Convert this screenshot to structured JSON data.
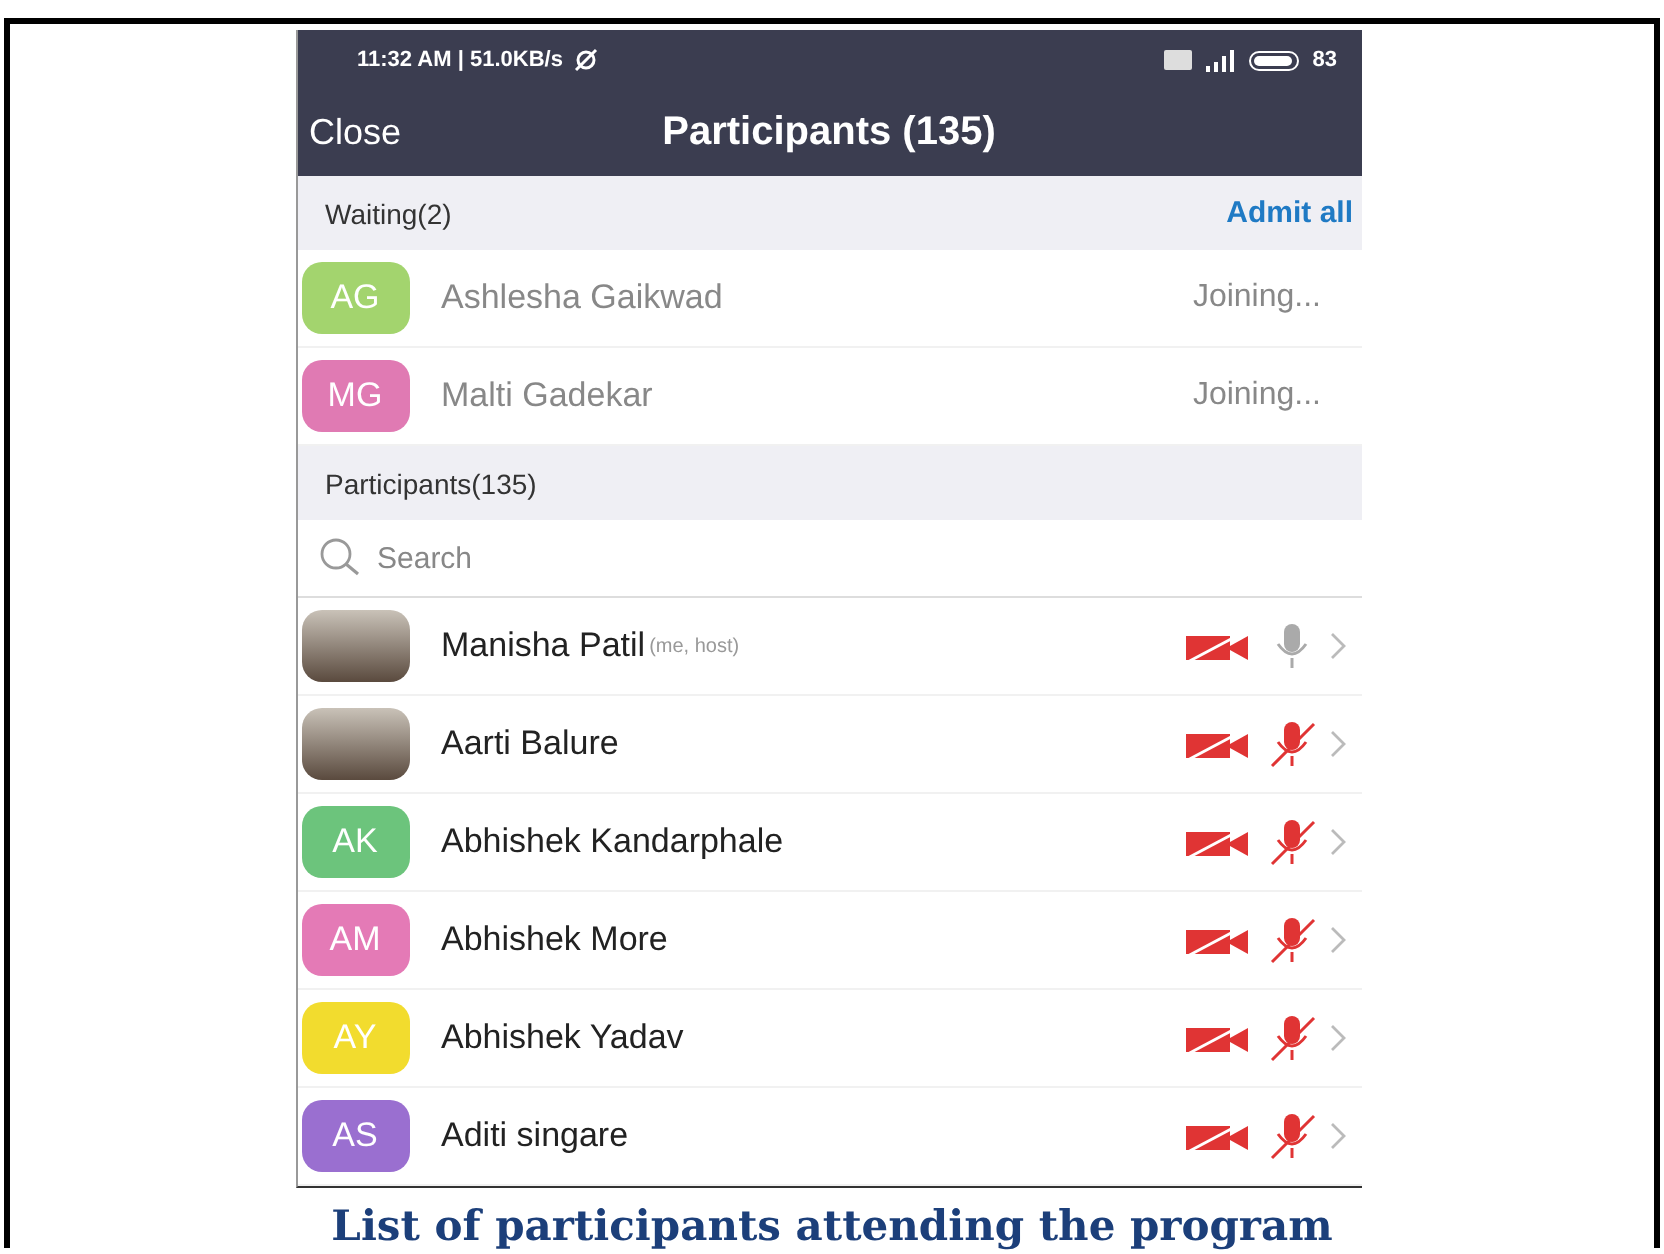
{
  "status_bar": {
    "time": "11:32 AM | 51.0KB/s",
    "battery": "83"
  },
  "nav": {
    "close": "Close",
    "title": "Participants (135)"
  },
  "waiting": {
    "header": "Waiting(2)",
    "admit_all": "Admit all",
    "people": [
      {
        "initials": "AG",
        "color": "#a3d46e",
        "name": "Ashlesha Gaikwad",
        "status": "Joining..."
      },
      {
        "initials": "MG",
        "color": "#e07ab3",
        "name": "Malti Gadekar",
        "status": "Joining..."
      }
    ]
  },
  "participants": {
    "header": "Participants(135)",
    "search": {
      "placeholder": "Search"
    },
    "people": [
      {
        "avatar": {
          "kind": "photo"
        },
        "name": "Manisha Patil",
        "note": "(me, host)",
        "video_muted": true,
        "mic_muted": false
      },
      {
        "avatar": {
          "kind": "photo"
        },
        "name": "Aarti Balure",
        "video_muted": true,
        "mic_muted": true
      },
      {
        "avatar": {
          "kind": "initials",
          "initials": "AK",
          "color": "#6cc47c"
        },
        "name": "Abhishek Kandarphale",
        "video_muted": true,
        "mic_muted": true
      },
      {
        "avatar": {
          "kind": "initials",
          "initials": "AM",
          "color": "#e47ab6"
        },
        "name": "Abhishek More",
        "video_muted": true,
        "mic_muted": true
      },
      {
        "avatar": {
          "kind": "initials",
          "initials": "AY",
          "color": "#f2dc2e"
        },
        "name": "Abhishek Yadav",
        "video_muted": true,
        "mic_muted": true
      },
      {
        "avatar": {
          "kind": "initials",
          "initials": "AS",
          "color": "#9a6fd0"
        },
        "name": "Aditi singare",
        "video_muted": true,
        "mic_muted": true
      }
    ]
  },
  "caption": "List of participants attending the program"
}
